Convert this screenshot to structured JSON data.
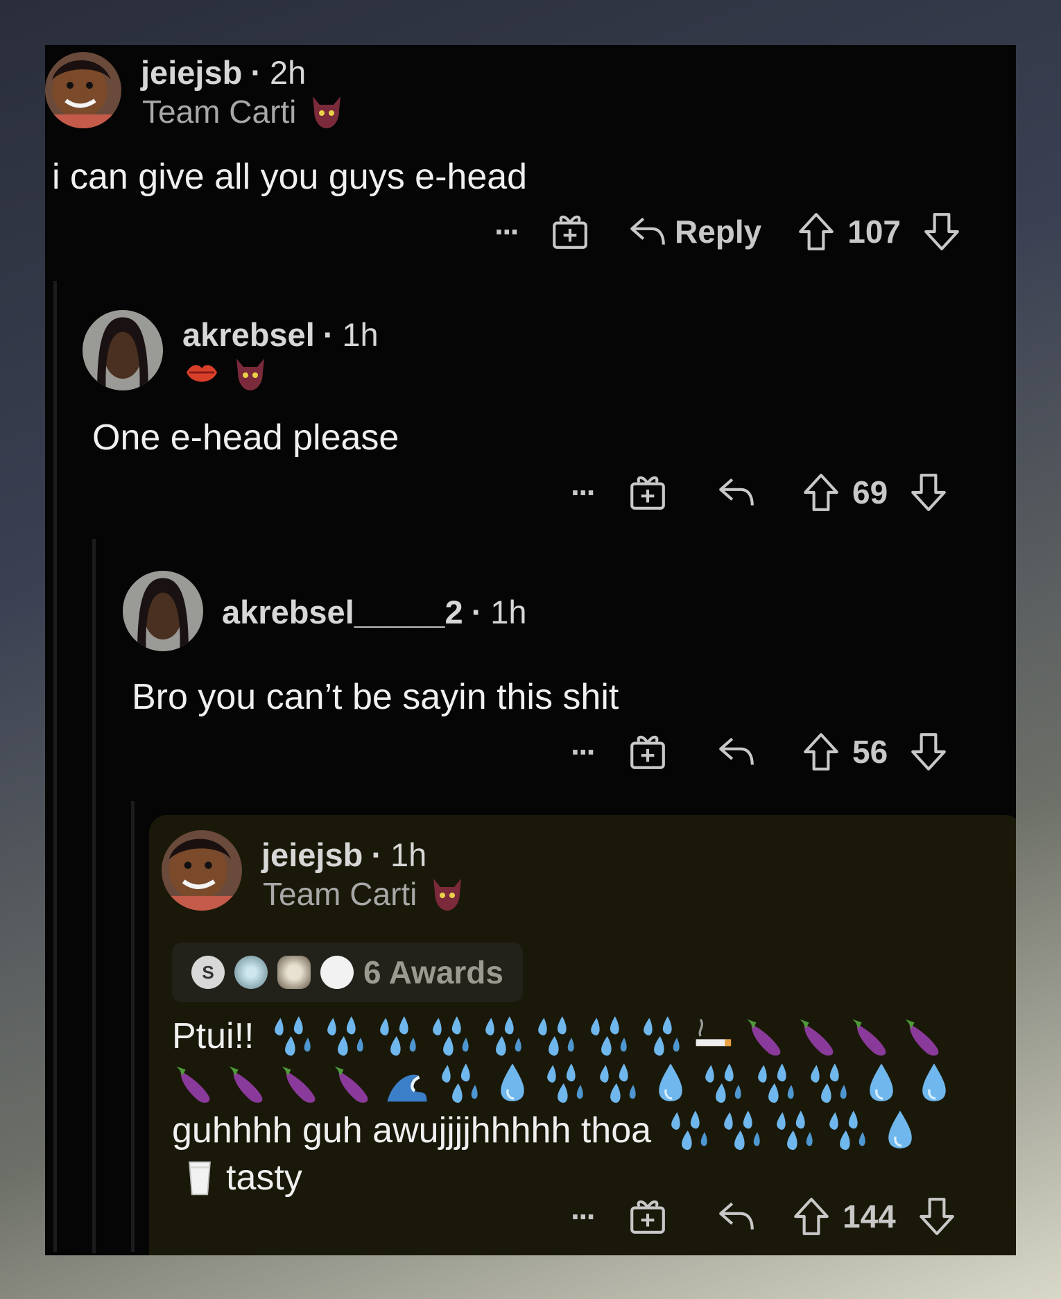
{
  "comments": [
    {
      "username": "jeiejsb",
      "time": "2h",
      "flair": "Team Carti",
      "body": "i can give all you guys e-head",
      "reply_label": "Reply",
      "votes": "107"
    },
    {
      "username": "akrebsel",
      "time": "1h",
      "flair": "",
      "body": "One e-head please",
      "votes": "69"
    },
    {
      "username": "akrebsel_____2",
      "time": "1h",
      "flair": "",
      "body": "Bro you can’t be sayin this shit",
      "votes": "56"
    },
    {
      "username": "jeiejsb",
      "time": "1h",
      "flair": "Team Carti",
      "awards_label": "6 Awards",
      "body_line1_text": "Ptui!!",
      "body_line3_text": "guhhhh guh awujjjjhhhhh thoa",
      "body_line4_text": "tasty",
      "votes": "144"
    }
  ],
  "separator": "·",
  "more_label": "···",
  "colors": {
    "frame_bg": "#050505",
    "highlight_bg": "#1a1808",
    "text": "#f0f0f0",
    "muted": "#a8a8a8",
    "water": "#6fb7ec",
    "eggplant": "#8a3a9a"
  },
  "icons": [
    "more-icon",
    "award-icon",
    "reply-icon",
    "upvote-icon",
    "downvote-icon",
    "sweat-droplets-icon",
    "droplet-icon",
    "eggplant-icon",
    "cigarette-icon",
    "wave-icon",
    "milk-icon",
    "kiss-icon",
    "devil-icon"
  ]
}
